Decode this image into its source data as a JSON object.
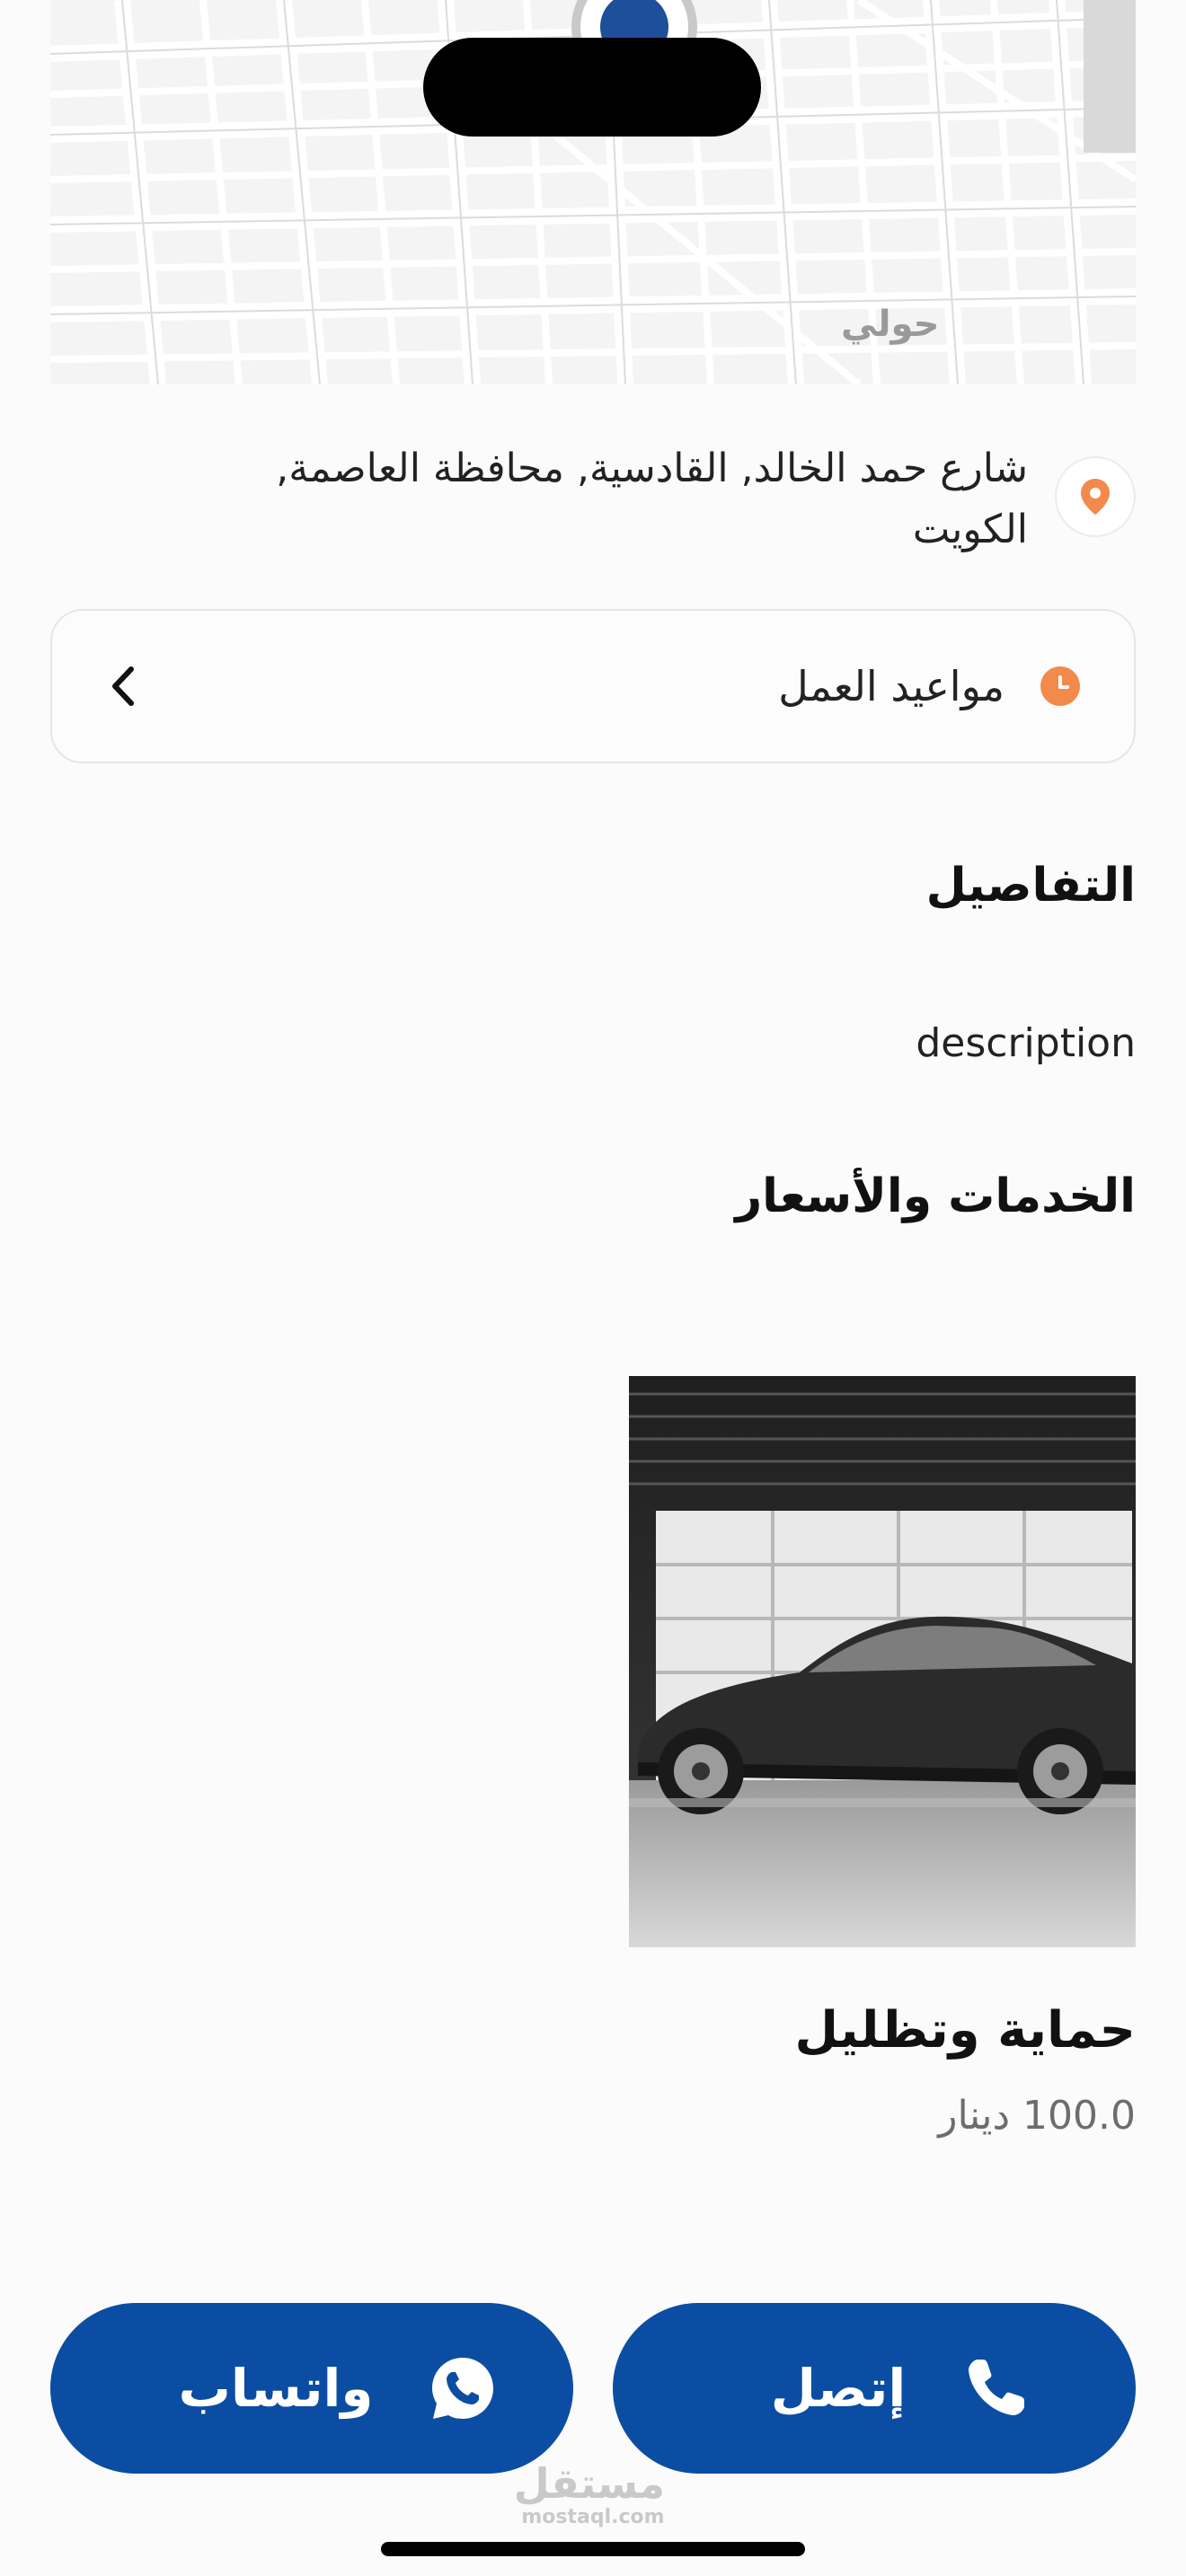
{
  "map": {
    "area_label": "حولي"
  },
  "address": {
    "text": "شارع حمد الخالد, القادسية, محافظة العاصمة, الكويت",
    "icon": "map-pin-icon",
    "icon_color": "#f28a4b"
  },
  "hours": {
    "label": "مواعيد العمل",
    "icon": "clock-icon",
    "chevron_icon": "chevron-left-icon"
  },
  "details": {
    "title": "التفاصيل",
    "description": "description"
  },
  "services": {
    "title": "الخدمات والأسعار",
    "items": [
      {
        "name": "حماية وتظليل",
        "price": "100.0 دينار",
        "image": "black-sedan-in-garage"
      }
    ]
  },
  "actions": {
    "call_label": "إتصل",
    "call_icon": "phone-icon",
    "whatsapp_label": "واتساب",
    "whatsapp_icon": "whatsapp-icon",
    "button_color": "#0b4da2"
  },
  "watermark": {
    "arabic": "مستقل",
    "latin": "mostaql.com"
  }
}
